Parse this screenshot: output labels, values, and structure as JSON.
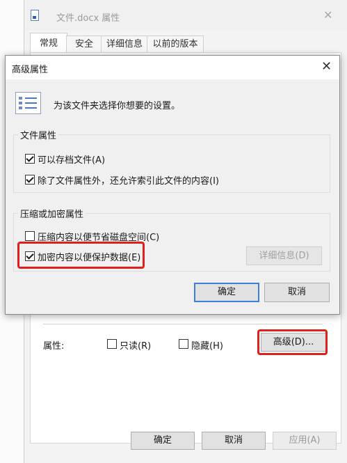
{
  "props_window": {
    "title": "文件.docx 属性",
    "close_glyph": "✕",
    "tabs": [
      {
        "label": "常规",
        "active": true
      },
      {
        "label": "安全",
        "active": false
      },
      {
        "label": "详细信息",
        "active": false
      },
      {
        "label": "以前的版本",
        "active": false
      }
    ],
    "attributes_label": "属性:",
    "readonly_label": "只读(R)",
    "readonly_checked": false,
    "hidden_label": "隐藏(H)",
    "hidden_checked": false,
    "advanced_label": "高级(D)...",
    "ok_label": "确定",
    "cancel_label": "取消",
    "apply_label": "应用(A)"
  },
  "advanced_dialog": {
    "title": "高级属性",
    "close_glyph": "✕",
    "description": "为该文件夹选择你想要的设置。",
    "file_attributes": {
      "title": "文件属性",
      "archive_label": "可以存档文件(A)",
      "archive_checked": true,
      "index_label": "除了文件属性外，还允许索引此文件的内容(I)",
      "index_checked": true
    },
    "compress_encrypt": {
      "title": "压缩或加密属性",
      "compress_label": "压缩内容以便节省磁盘空间(C)",
      "compress_checked": false,
      "encrypt_label": "加密内容以便保护数据(E)",
      "encrypt_checked": true,
      "details_label": "详细信息(D)"
    },
    "ok_label": "确定",
    "cancel_label": "取消"
  },
  "colors": {
    "highlight": "#e0201e",
    "default_button_border": "#3c7fd6"
  }
}
